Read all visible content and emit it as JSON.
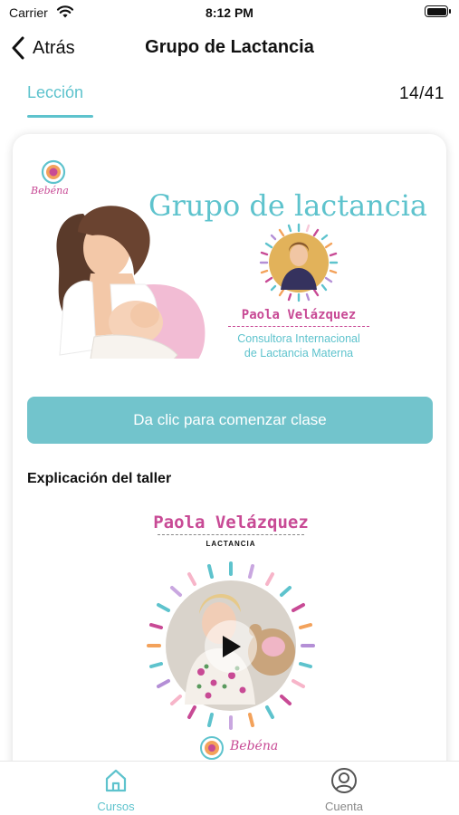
{
  "status_bar": {
    "carrier": "Carrier",
    "time": "8:12 PM"
  },
  "nav": {
    "back_label": "Atrás",
    "title": "Grupo de Lactancia"
  },
  "lesson_tabs": {
    "active_tab": "Lección",
    "progress": "14/41"
  },
  "banner": {
    "logo_text": "Bebéna",
    "title": "Grupo de lactancia",
    "speaker_name": "Paola Velázquez",
    "speaker_role_line1": "Consultora Internacional",
    "speaker_role_line2": "de Lactancia Materna"
  },
  "start_button": {
    "label": "Da clic para comenzar clase"
  },
  "workshop": {
    "section_title": "Explicación del taller",
    "video_speaker": "Paola Velázquez",
    "video_subtitle": "LACTANCIA",
    "video_logo_text": "Bebéna"
  },
  "tab_bar": {
    "items": [
      {
        "label": "Cursos",
        "icon": "home-icon"
      },
      {
        "label": "Cuenta",
        "icon": "account-icon"
      }
    ]
  },
  "colors": {
    "accent": "#5ec3cd",
    "button": "#72c4cc",
    "brand_pink": "#c84a95"
  }
}
